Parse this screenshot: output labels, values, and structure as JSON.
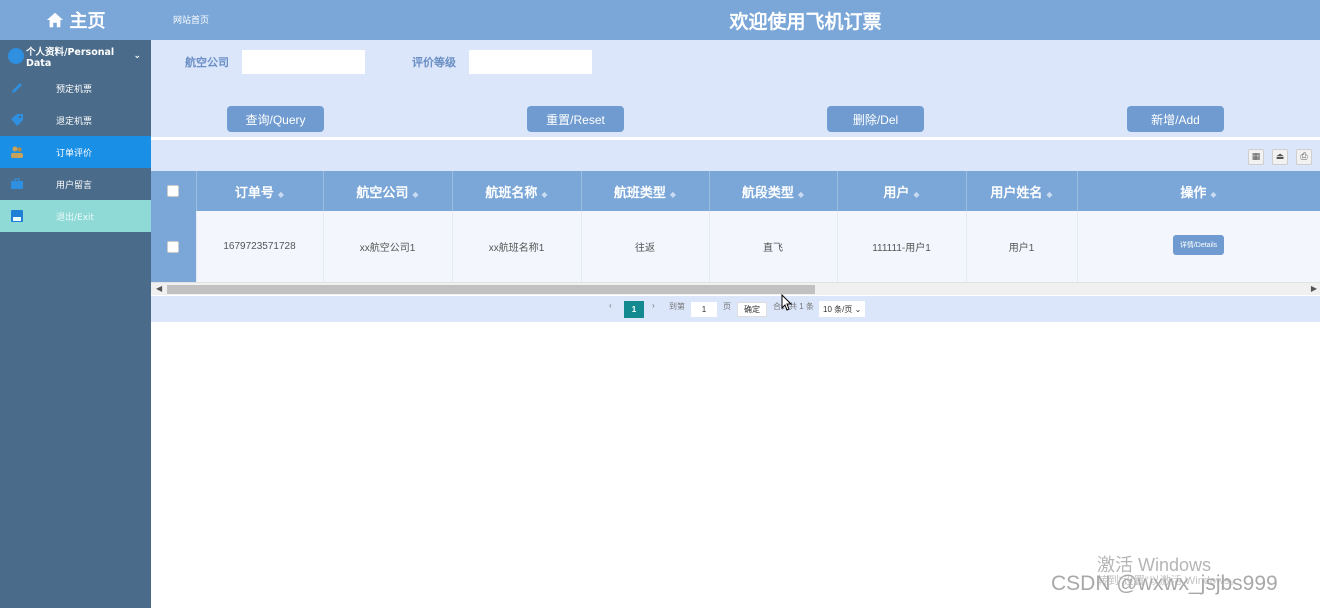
{
  "sidebar": {
    "brand": "主页",
    "group": "个人资料/Personal Data",
    "items": [
      {
        "label": "预定机票"
      },
      {
        "label": "退定机票"
      },
      {
        "label": "订单评价"
      },
      {
        "label": "用户留言"
      },
      {
        "label": "退出/Exit"
      }
    ]
  },
  "header": {
    "home_link": "网站首页",
    "title": "欢迎使用飞机订票"
  },
  "search": {
    "airline_label": "航空公司",
    "airline_value": "",
    "rating_label": "评价等级",
    "rating_value": "",
    "query_btn": "查询/Query",
    "reset_btn": "重置/Reset",
    "delete_btn": "删除/Del",
    "add_btn": "新增/Add"
  },
  "colors": {
    "header_blue": "#7aa6d8",
    "panel_bg": "#dbe6fb",
    "sidebar_bg": "#4a6b8a",
    "active_item": "#1a8fe6",
    "exit_item": "#8fd9d6",
    "button": "#6f9bd0",
    "page_current": "#128a90"
  },
  "table": {
    "columns": [
      "订单号",
      "航空公司",
      "航班名称",
      "航班类型",
      "航段类型",
      "用户",
      "用户姓名",
      "操作"
    ],
    "rows": [
      {
        "order_no": "1679723571728",
        "airline": "xx航空公司1",
        "flight_name": "xx航班名称1",
        "flight_type": "往返",
        "segment_type": "直飞",
        "user": "111111-用户1",
        "user_name": "用户1",
        "action": "详情/Details"
      }
    ]
  },
  "pagination": {
    "current": "1",
    "goto_label": "到第",
    "page_input": "1",
    "page_unit": "页",
    "confirm": "确定",
    "total": "合计共 1 条",
    "page_size": "10 条/页"
  },
  "watermark": {
    "activate": "激活 Windows",
    "activate_sub": "转到\"设置\"以激活 Windows。",
    "csdn": "CSDN @wxwx_jsjbs999"
  }
}
